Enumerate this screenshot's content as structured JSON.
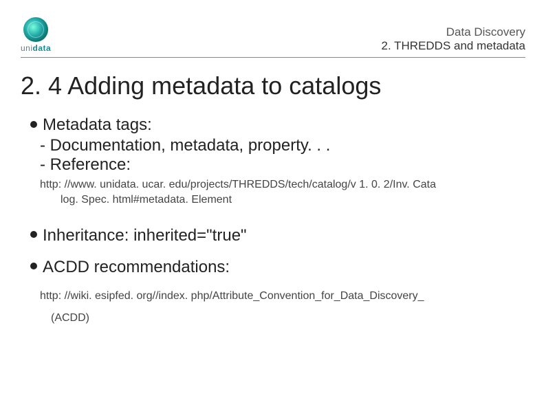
{
  "header": {
    "logo_uni": "uni",
    "logo_data": "data",
    "top": "Data Discovery",
    "sub": "2. THREDDS and metadata"
  },
  "title": "2. 4 Adding metadata to catalogs",
  "body": {
    "meta_tags": "Metadata tags:",
    "sub_doc": "- Documentation, metadata, property. . .",
    "sub_ref": "- Reference:",
    "ref_url_1": "http: //www. unidata. ucar. edu/projects/THREDDS/tech/catalog/v 1. 0. 2/Inv. Cata",
    "ref_url_2": "log. Spec. html#metadata. Element",
    "inheritance": "Inheritance: inherited=\"true\"",
    "acdd": "ACDD recommendations:",
    "acdd_url": "http: //wiki. esipfed. org//index. php/Attribute_Convention_for_Data_Discovery_",
    "acdd_sub": "(ACDD)"
  }
}
